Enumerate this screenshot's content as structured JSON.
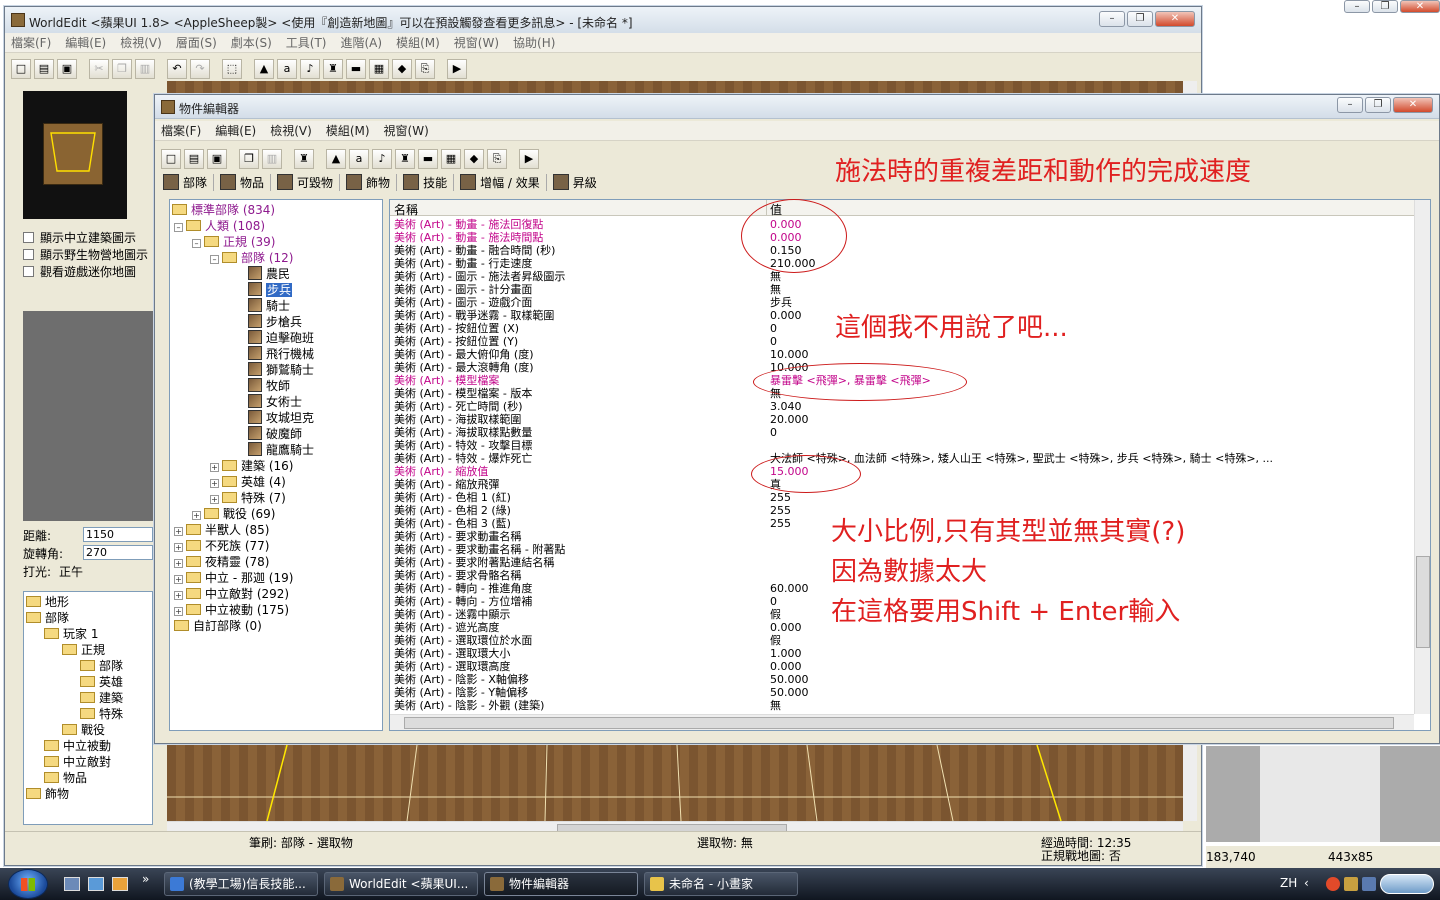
{
  "main_window": {
    "title": "WorldEdit <蘋果UI 1.8> <AppleSheep製> <使用『創造新地圖』可以在預設觸發查看更多訊息> - [未命名 *]",
    "menu": [
      "檔案(F)",
      "編輯(E)",
      "檢視(V)",
      "層面(S)",
      "劇本(S)",
      "工具(T)",
      "進階(A)",
      "模組(M)",
      "視窗(W)",
      "協助(H)"
    ],
    "checkboxes": [
      "顯示中立建築圖示",
      "顯示野生物營地圖示",
      "觀看遊戲迷你地圖"
    ],
    "camera": {
      "distance_label": "距離:",
      "distance_value": "1150",
      "rotation_label": "旋轉角:",
      "rotation_value": "270",
      "lighting_label": "打光:",
      "lighting_value": "正午"
    },
    "layer_tree": [
      "地形",
      "部隊",
      "玩家 1",
      "正規",
      "部隊",
      "英雄",
      "建築",
      "特殊",
      "戰役",
      "中立被動",
      "中立敵對",
      "物品",
      "飾物"
    ],
    "status": {
      "brush": "筆刷: 部隊 - 選取物",
      "selection": "選取物: 無",
      "elapsed": "經過時間: 12:35",
      "melee": "正規戰地圖: 否",
      "coords": "183,740",
      "size": "443x85"
    }
  },
  "object_editor": {
    "title": "物件編輯器",
    "menu": [
      "檔案(F)",
      "編輯(E)",
      "檢視(V)",
      "模組(M)",
      "視窗(W)"
    ],
    "tabs": [
      "部隊",
      "物品",
      "可毀物",
      "飾物",
      "技能",
      "增幅 / 效果",
      "昇級"
    ],
    "tree": {
      "root": "標準部隊 (834)",
      "human": "人類 (108)",
      "melee": "正規 (39)",
      "units": "部隊 (12)",
      "unit_list": [
        "農民",
        "步兵",
        "騎士",
        "步槍兵",
        "迫擊砲班",
        "飛行機械",
        "獅鷲騎士",
        "牧師",
        "女術士",
        "攻城坦克",
        "破魔師",
        "龍鷹騎士"
      ],
      "human_sub": [
        "建築 (16)",
        "英雄 (4)",
        "特殊 (7)"
      ],
      "campaign": "戰役 (69)",
      "races": [
        "半獸人 (85)",
        "不死族 (77)",
        "夜精靈 (78)",
        "中立 - 那迦 (19)",
        "中立敵對 (292)",
        "中立被動 (175)"
      ],
      "custom": "自訂部隊 (0)"
    },
    "columns": {
      "name": "名稱",
      "value": "值"
    },
    "rows": [
      {
        "name": "美術 (Art) - 動畫 - 施法回復點",
        "value": "0.000",
        "hl": true
      },
      {
        "name": "美術 (Art) - 動畫 - 施法時間點",
        "value": "0.000",
        "hl": true
      },
      {
        "name": "美術 (Art) - 動畫 - 融合時間 (秒)",
        "value": "0.150",
        "hl": false
      },
      {
        "name": "美術 (Art) - 動畫 - 行走速度",
        "value": "210.000",
        "hl": false
      },
      {
        "name": "美術 (Art) - 圖示 - 施法者昇級圖示",
        "value": "無",
        "hl": false
      },
      {
        "name": "美術 (Art) - 圖示 - 計分畫面",
        "value": "無",
        "hl": false
      },
      {
        "name": "美術 (Art) - 圖示 - 遊戲介面",
        "value": "步兵",
        "hl": false
      },
      {
        "name": "美術 (Art) - 戰爭迷霧 - 取樣範圍",
        "value": "0.000",
        "hl": false
      },
      {
        "name": "美術 (Art) - 按鈕位置 (X)",
        "value": "0",
        "hl": false
      },
      {
        "name": "美術 (Art) - 按鈕位置 (Y)",
        "value": "0",
        "hl": false
      },
      {
        "name": "美術 (Art) - 最大俯仰角 (度)",
        "value": "10.000",
        "hl": false
      },
      {
        "name": "美術 (Art) - 最大滾轉角 (度)",
        "value": "10.000",
        "hl": false
      },
      {
        "name": "美術 (Art) - 模型檔案",
        "value": "暴雷擊 <飛彈>, 暴雷擊 <飛彈>",
        "hl": true
      },
      {
        "name": "美術 (Art) - 模型檔案 - 版本",
        "value": "無",
        "hl": false
      },
      {
        "name": "美術 (Art) - 死亡時間 (秒)",
        "value": "3.040",
        "hl": false
      },
      {
        "name": "美術 (Art) - 海拔取樣範圍",
        "value": "20.000",
        "hl": false
      },
      {
        "name": "美術 (Art) - 海拔取樣點數量",
        "value": "0",
        "hl": false
      },
      {
        "name": "美術 (Art) - 特效 - 攻擊目標",
        "value": "",
        "hl": false
      },
      {
        "name": "美術 (Art) - 特效 - 爆炸死亡",
        "value": "大法師 <特殊>, 血法師 <特殊>, 矮人山王 <特殊>, 聖武士 <特殊>, 步兵 <特殊>, 騎士 <特殊>, ...",
        "hl": false
      },
      {
        "name": "美術 (Art) - 縮放值",
        "value": "15.000",
        "hl": true
      },
      {
        "name": "美術 (Art) - 縮放飛彈",
        "value": "真",
        "hl": false
      },
      {
        "name": "美術 (Art) - 色相 1 (紅)",
        "value": "255",
        "hl": false
      },
      {
        "name": "美術 (Art) - 色相 2 (綠)",
        "value": "255",
        "hl": false
      },
      {
        "name": "美術 (Art) - 色相 3 (藍)",
        "value": "255",
        "hl": false
      },
      {
        "name": "美術 (Art) - 要求動畫名稱",
        "value": "",
        "hl": false
      },
      {
        "name": "美術 (Art) - 要求動畫名稱 - 附著點",
        "value": "",
        "hl": false
      },
      {
        "name": "美術 (Art) - 要求附著點連結名稱",
        "value": "",
        "hl": false
      },
      {
        "name": "美術 (Art) - 要求骨骼名稱",
        "value": "",
        "hl": false
      },
      {
        "name": "美術 (Art) - 轉向 - 推進角度",
        "value": "60.000",
        "hl": false
      },
      {
        "name": "美術 (Art) - 轉向 - 方位增補",
        "value": "0",
        "hl": false
      },
      {
        "name": "美術 (Art) - 迷霧中顯示",
        "value": "假",
        "hl": false
      },
      {
        "name": "美術 (Art) - 遮光高度",
        "value": "0.000",
        "hl": false
      },
      {
        "name": "美術 (Art) - 選取環位於水面",
        "value": "假",
        "hl": false
      },
      {
        "name": "美術 (Art) - 選取環大小",
        "value": "1.000",
        "hl": false
      },
      {
        "name": "美術 (Art) - 選取環高度",
        "value": "0.000",
        "hl": false
      },
      {
        "name": "美術 (Art) - 陰影 - X軸偏移",
        "value": "50.000",
        "hl": false
      },
      {
        "name": "美術 (Art) - 陰影 - Y軸偏移",
        "value": "50.000",
        "hl": false
      },
      {
        "name": "美術 (Art) - 陰影 - 外觀 (建築)",
        "value": "無",
        "hl": false
      }
    ]
  },
  "annotations": {
    "cast_note": "施法時的重複差距和動作的完成速度",
    "model_note": "這個我不用說了吧...",
    "scale_note_1": "大小比例,只有其型並無其實(?)",
    "scale_note_2": "因為數據太大",
    "scale_note_3": "在這格要用Shift + Enter輸入"
  },
  "taskbar": {
    "buttons": [
      "(教學工場)信長技能...",
      "WorldEdit <蘋果UI...",
      "物件編輯器",
      "未命名 - 小畫家"
    ],
    "lang": "ZH"
  },
  "colors": {
    "highlight": "#c2058a",
    "annotation": "#e02020",
    "selection": "#316ac5"
  }
}
